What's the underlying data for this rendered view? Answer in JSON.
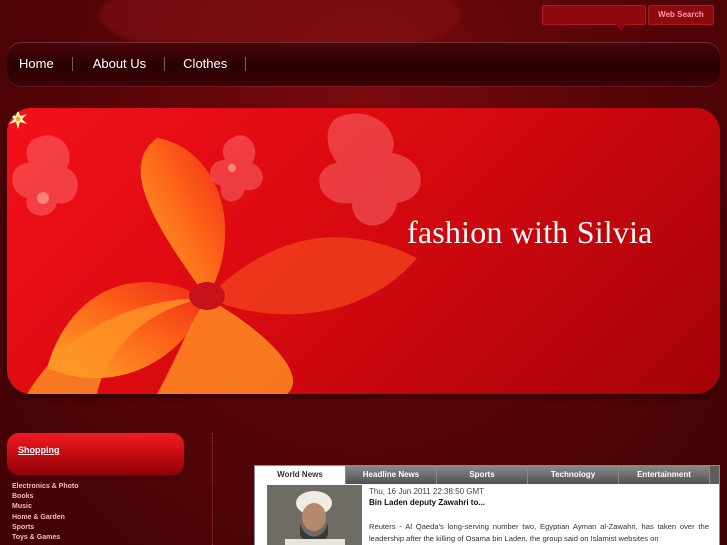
{
  "search": {
    "value": "",
    "button_label": "Web Search"
  },
  "nav": {
    "items": [
      {
        "label": "Home"
      },
      {
        "label": "About Us"
      },
      {
        "label": "Clothes"
      }
    ]
  },
  "banner": {
    "title": "fashion with Silvia"
  },
  "sidebar": {
    "title": "Shopping",
    "links": [
      {
        "label": "Electronics & Photo"
      },
      {
        "label": "Books"
      },
      {
        "label": "Music"
      },
      {
        "label": "Home & Garden"
      },
      {
        "label": "Sports"
      },
      {
        "label": "Toys & Games"
      }
    ]
  },
  "news": {
    "tabs": [
      {
        "label": "World News",
        "active": true
      },
      {
        "label": "Headline News"
      },
      {
        "label": "Sports"
      },
      {
        "label": "Technology"
      },
      {
        "label": "Entertainment"
      }
    ],
    "article": {
      "date": "Thu, 16 Jun 2011 22:38:50 GMT",
      "headline": "Bin Laden deputy Zawahri to...",
      "body": "Reuters - Al Qaeda's long-serving number two, Egyptian Ayman al-Zawahri, has taken over the leadership after the killing of Osama bin Laden, the group said on Islamist websites on"
    }
  },
  "colors": {
    "background": "#5a0508",
    "banner_red": "#e00c14",
    "accent_text": "#ffb8b8"
  }
}
